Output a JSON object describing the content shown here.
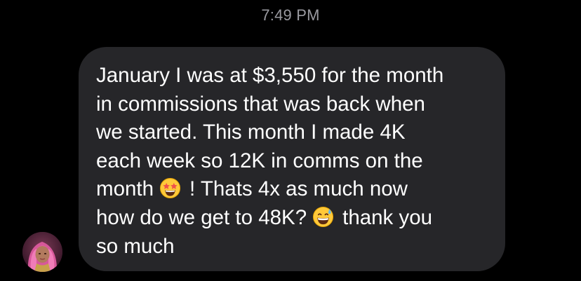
{
  "conversation": {
    "timestamp": "7:49 PM",
    "message": {
      "lines": [
        "January I was at $3,550 for the month",
        "in commissions that was back when",
        "we started. This month I made 4K",
        "each week so 12K in comms on the"
      ],
      "line5_before_emoji": "month",
      "line5_after_emoji": "! Thats 4x as much now",
      "line6_before_emoji": "how do we get to 48K?",
      "line6_after_emoji": "thank you",
      "line7": "so much",
      "emoji_1": "star-struck-emoji",
      "emoji_2": "grinning-sweat-emoji"
    }
  },
  "sender": {
    "avatar": "sender-avatar-photo"
  },
  "colors": {
    "background": "#000000",
    "bubble": "#262629",
    "text": "#ffffff",
    "timestamp": "#9a9aa0"
  }
}
